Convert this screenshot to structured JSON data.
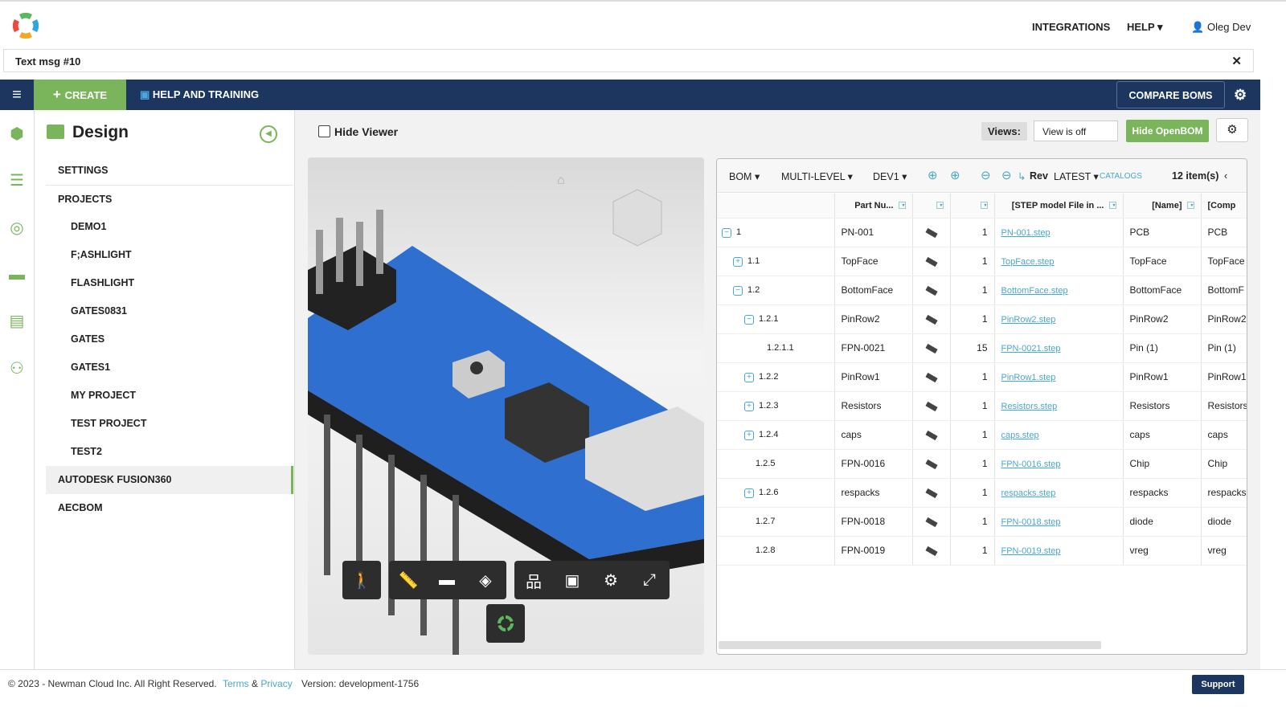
{
  "header": {
    "integrations": "INTEGRATIONS",
    "help": "HELP ▾",
    "user": "Oleg Dev"
  },
  "message": {
    "text": "Text msg #10",
    "close": "✕"
  },
  "nav": {
    "create": "CREATE",
    "help_training": "HELP AND TRAINING",
    "compare": "COMPARE BOMS"
  },
  "sidebar": {
    "title": "Design",
    "items": [
      {
        "label": "SETTINGS",
        "sub": false
      },
      {
        "label": "PROJECTS",
        "sub": false
      },
      {
        "label": "DEMO1",
        "sub": true
      },
      {
        "label": "F;ASHLIGHT",
        "sub": true
      },
      {
        "label": "FLASHLIGHT",
        "sub": true
      },
      {
        "label": "GATES0831",
        "sub": true
      },
      {
        "label": "GATES",
        "sub": true
      },
      {
        "label": "GATES1",
        "sub": true
      },
      {
        "label": "MY PROJECT",
        "sub": true
      },
      {
        "label": "TEST PROJECT",
        "sub": true
      },
      {
        "label": "TEST2",
        "sub": true
      },
      {
        "label": "AUTODESK FUSION360",
        "sub": false,
        "active": true
      },
      {
        "label": "AECBOM",
        "sub": false
      }
    ]
  },
  "toolbar": {
    "hide_viewer": "Hide Viewer",
    "views_label": "Views:",
    "views_value": "View is off",
    "hide_openbom": "Hide OpenBOM"
  },
  "bom": {
    "bom": "BOM ▾",
    "level": "MULTI-LEVEL ▾",
    "dev": "DEV1 ▾",
    "rev": "Rev",
    "latest": "LATEST ▾",
    "catalogs": "CATALOGS",
    "count": "12 item(s)",
    "headers": [
      "",
      "Part Nu...",
      "",
      "",
      "[STEP model File in ...",
      "[Name]",
      "[Comp"
    ],
    "rows": [
      {
        "lvl": "1",
        "d": 0,
        "t": "−",
        "pn": "PN-001",
        "q": "1",
        "f": "PN-001.step",
        "n": "PCB",
        "c": "PCB"
      },
      {
        "lvl": "1.1",
        "d": 1,
        "t": "+",
        "pn": "TopFace",
        "q": "1",
        "f": "TopFace.step",
        "n": "TopFace",
        "c": "TopFace"
      },
      {
        "lvl": "1.2",
        "d": 1,
        "t": "−",
        "pn": "BottomFace",
        "q": "1",
        "f": "BottomFace.step",
        "n": "BottomFace",
        "c": "BottomF"
      },
      {
        "lvl": "1.2.1",
        "d": 2,
        "t": "−",
        "pn": "PinRow2",
        "q": "1",
        "f": "PinRow2.step",
        "n": "PinRow2",
        "c": "PinRow2"
      },
      {
        "lvl": "1.2.1.1",
        "d": 4,
        "t": "",
        "pn": "FPN-0021",
        "q": "15",
        "f": "FPN-0021.step",
        "n": "Pin (1)",
        "c": "Pin (1)"
      },
      {
        "lvl": "1.2.2",
        "d": 2,
        "t": "+",
        "pn": "PinRow1",
        "q": "1",
        "f": "PinRow1.step",
        "n": "PinRow1",
        "c": "PinRow1"
      },
      {
        "lvl": "1.2.3",
        "d": 2,
        "t": "+",
        "pn": "Resistors",
        "q": "1",
        "f": "Resistors.step",
        "n": "Resistors",
        "c": "Resistors"
      },
      {
        "lvl": "1.2.4",
        "d": 2,
        "t": "+",
        "pn": "caps",
        "q": "1",
        "f": "caps.step",
        "n": "caps",
        "c": "caps"
      },
      {
        "lvl": "1.2.5",
        "d": 3,
        "t": "",
        "pn": "FPN-0016",
        "q": "1",
        "f": "FPN-0016.step",
        "n": "Chip",
        "c": "Chip"
      },
      {
        "lvl": "1.2.6",
        "d": 2,
        "t": "+",
        "pn": "respacks",
        "q": "1",
        "f": "respacks.step",
        "n": "respacks",
        "c": "respacks"
      },
      {
        "lvl": "1.2.7",
        "d": 3,
        "t": "",
        "pn": "FPN-0018",
        "q": "1",
        "f": "FPN-0018.step",
        "n": "diode",
        "c": "diode"
      },
      {
        "lvl": "1.2.8",
        "d": 3,
        "t": "",
        "pn": "FPN-0019",
        "q": "1",
        "f": "FPN-0019.step",
        "n": "vreg",
        "c": "vreg"
      }
    ]
  },
  "footer": {
    "copy": "© 2023 - Newman Cloud Inc. All Right Reserved.",
    "terms": "Terms",
    "amp": "&",
    "privacy": "Privacy",
    "version": "Version: development-1756",
    "support": "Support"
  }
}
